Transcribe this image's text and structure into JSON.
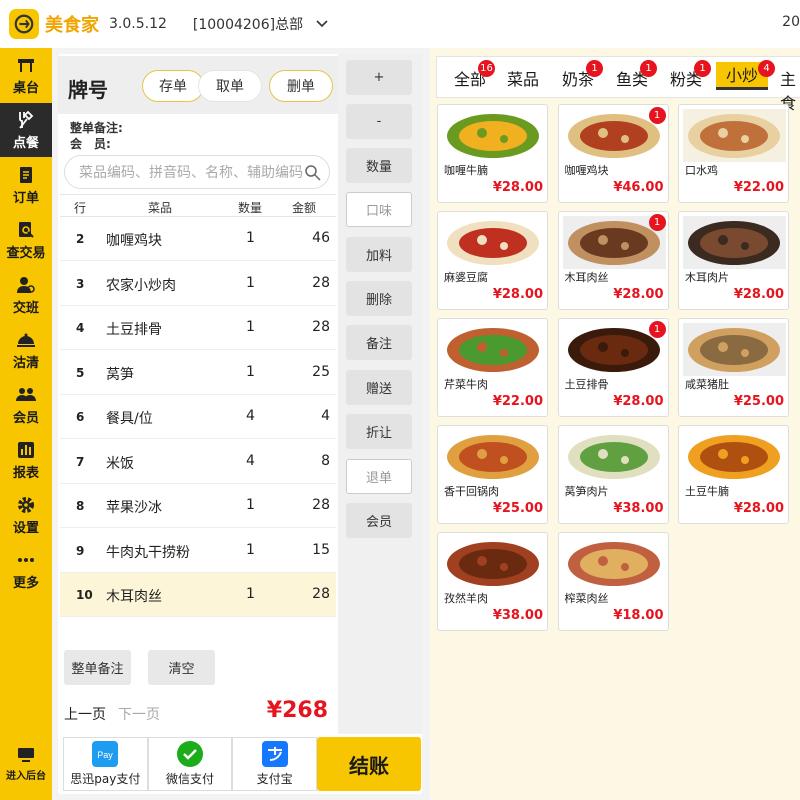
{
  "titlebar": {
    "app_name": "美食家",
    "version": "3.0.5.12",
    "store": "[10004206]总部",
    "clock_fragment": "20"
  },
  "sidebar": {
    "items": [
      {
        "label": "桌台",
        "icon": "table-icon"
      },
      {
        "label": "点餐",
        "icon": "utensils-icon",
        "active": true
      },
      {
        "label": "订单",
        "icon": "order-icon"
      },
      {
        "label": "查交易",
        "icon": "search-doc-icon"
      },
      {
        "label": "交班",
        "icon": "handover-icon"
      },
      {
        "label": "沽清",
        "icon": "soldout-icon"
      },
      {
        "label": "会员",
        "icon": "members-icon"
      },
      {
        "label": "报表",
        "icon": "chart-icon"
      },
      {
        "label": "设置",
        "icon": "gear-icon"
      },
      {
        "label": "更多",
        "icon": "more-icon"
      }
    ],
    "backend": "进入后台"
  },
  "order": {
    "title": "牌号",
    "buttons": [
      "存单",
      "取单",
      "删单"
    ],
    "note_label": "整单备注:",
    "member_label": "会　员:",
    "search_placeholder": "菜品编码、拼音码、名称、辅助编码",
    "columns": [
      "行",
      "菜品",
      "数量",
      "金额"
    ],
    "rows": [
      {
        "idx": "2",
        "name": "咖喱鸡块",
        "qty": "1",
        "amt": "46"
      },
      {
        "idx": "3",
        "name": "农家小炒肉",
        "qty": "1",
        "amt": "28"
      },
      {
        "idx": "4",
        "name": "土豆排骨",
        "qty": "1",
        "amt": "28"
      },
      {
        "idx": "5",
        "name": "莴笋",
        "qty": "1",
        "amt": "25"
      },
      {
        "idx": "6",
        "name": "餐具/位",
        "qty": "4",
        "amt": "4"
      },
      {
        "idx": "7",
        "name": "米饭",
        "qty": "4",
        "amt": "8"
      },
      {
        "idx": "8",
        "name": "苹果沙冰",
        "qty": "1",
        "amt": "28"
      },
      {
        "idx": "9",
        "name": "牛肉丸干捞粉",
        "qty": "1",
        "amt": "15"
      },
      {
        "idx": "10",
        "name": "木耳肉丝",
        "qty": "1",
        "amt": "28"
      }
    ],
    "bottom_buttons": {
      "note": "整单备注",
      "clear": "清空"
    },
    "pager": {
      "prev": "上一页",
      "next": "下一页"
    },
    "total": "¥268"
  },
  "pay": {
    "items": [
      {
        "label": "思迅pay支付",
        "icon": "sxpay-icon",
        "color": "#1e9cf0"
      },
      {
        "label": "微信支付",
        "icon": "wechat-icon",
        "color": "#1aad19"
      },
      {
        "label": "支付宝",
        "icon": "alipay-icon",
        "color": "#1677ff"
      }
    ],
    "checkout": "结账"
  },
  "ops": [
    "+",
    "-",
    "数量",
    "口味",
    "加料",
    "删除",
    "备注",
    "赠送",
    "折让",
    "退单",
    "会员"
  ],
  "categories": [
    {
      "label": "全部",
      "badge": "16"
    },
    {
      "label": "菜品",
      "badge": ""
    },
    {
      "label": "奶茶",
      "badge": "1"
    },
    {
      "label": "鱼类",
      "badge": "1"
    },
    {
      "label": "粉类",
      "badge": "1"
    },
    {
      "label": "小炒",
      "badge": "4",
      "active": true
    },
    {
      "label": "主食",
      "badge": ""
    }
  ],
  "dishes": [
    {
      "name": "咖喱牛腩",
      "price": "¥28.00",
      "badge": ""
    },
    {
      "name": "咖喱鸡块",
      "price": "¥46.00",
      "badge": "1"
    },
    {
      "name": "口水鸡",
      "price": "¥22.00",
      "badge": ""
    },
    {
      "name": "麻婆豆腐",
      "price": "¥28.00",
      "badge": ""
    },
    {
      "name": "木耳肉丝",
      "price": "¥28.00",
      "badge": "1"
    },
    {
      "name": "木耳肉片",
      "price": "¥28.00",
      "badge": ""
    },
    {
      "name": "芹菜牛肉",
      "price": "¥22.00",
      "badge": ""
    },
    {
      "name": "土豆排骨",
      "price": "¥28.00",
      "badge": "1"
    },
    {
      "name": "咸菜猪肚",
      "price": "¥25.00",
      "badge": ""
    },
    {
      "name": "香干回锅肉",
      "price": "¥25.00",
      "badge": ""
    },
    {
      "name": "莴笋肉片",
      "price": "¥38.00",
      "badge": ""
    },
    {
      "name": "土豆牛腩",
      "price": "¥28.00",
      "badge": ""
    },
    {
      "name": "孜然羊肉",
      "price": "¥38.00",
      "badge": ""
    },
    {
      "name": "榨菜肉丝",
      "price": "¥18.00",
      "badge": ""
    }
  ],
  "colors": {
    "brand": "#f7c600",
    "price": "#e5141e",
    "badge": "#e5141e"
  }
}
